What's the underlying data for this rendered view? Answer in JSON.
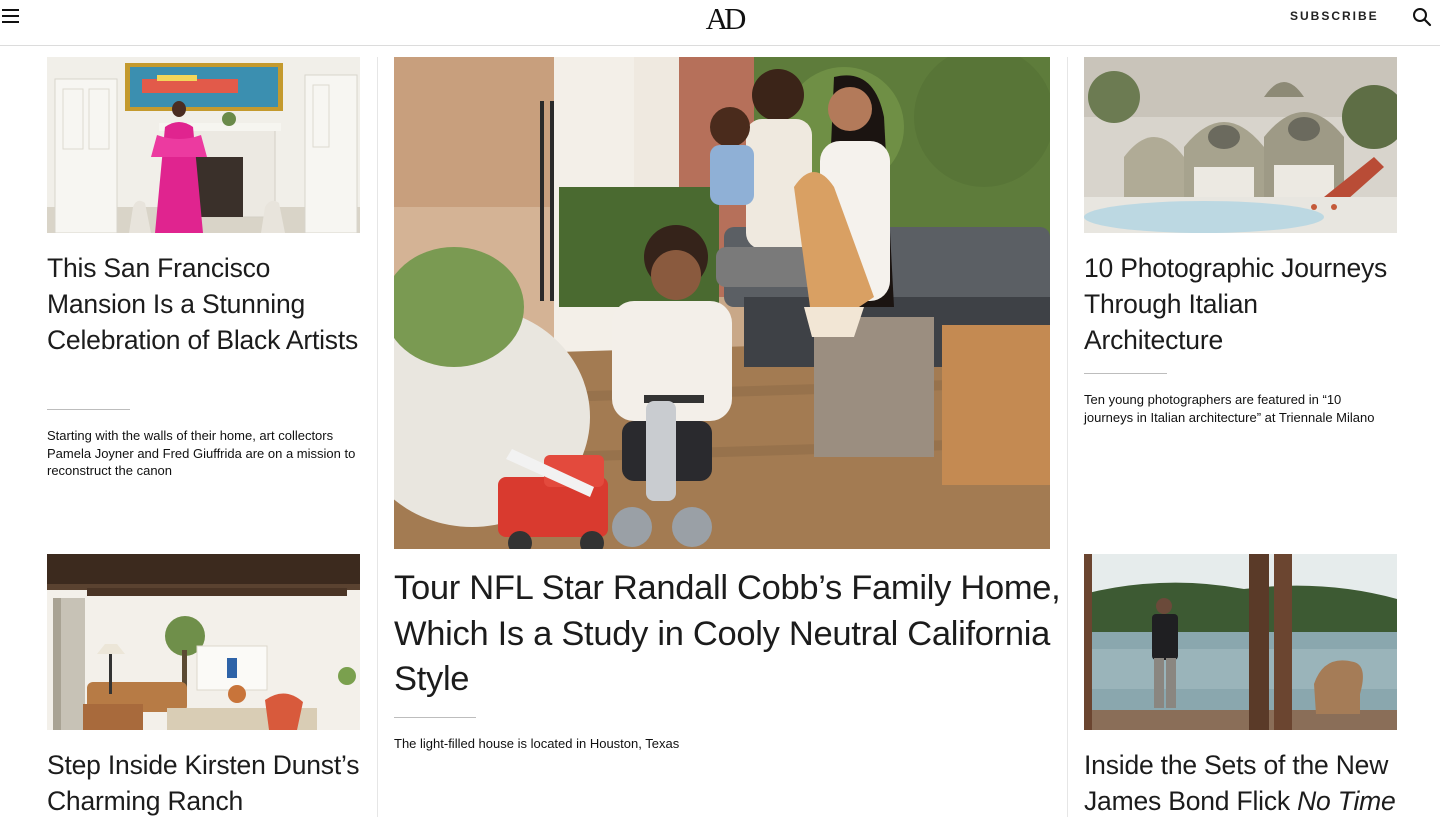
{
  "header": {
    "logo": "AD",
    "subscribe_label": "SUBSCRIBE",
    "icons": [
      "menu-icon",
      "search-icon"
    ]
  },
  "articles": {
    "left_top": {
      "headline": "This San Francisco Mansion Is a Stunning Celebration of Black Artists",
      "dek": "Starting with the walls of their home, art collectors Pamela Joyner and Fred Giuffrida are on a mission to reconstruct the canon"
    },
    "left_bottom": {
      "headline": "Step Inside Kirsten Dunst’s Charming Ranch"
    },
    "main": {
      "headline": "Tour NFL Star Randall Cobb’s Family Home, Which Is a Study in Cooly Neutral California Style",
      "dek": "The light-filled house is located in Houston, Texas"
    },
    "right_top": {
      "headline": "10 Photographic Journeys Through Italian Architecture",
      "dek": "Ten young photographers are featured in “10 journeys in Italian architecture” at Triennale Milano"
    },
    "right_bottom": {
      "headline_prefix": "Inside the Sets of the New James Bond Flick ",
      "headline_italic": "No Time"
    }
  },
  "colors": {
    "text": "#1a1a1a",
    "rule": "#bdbdbd",
    "divider": "#e6e6e6",
    "background": "#ffffff"
  }
}
